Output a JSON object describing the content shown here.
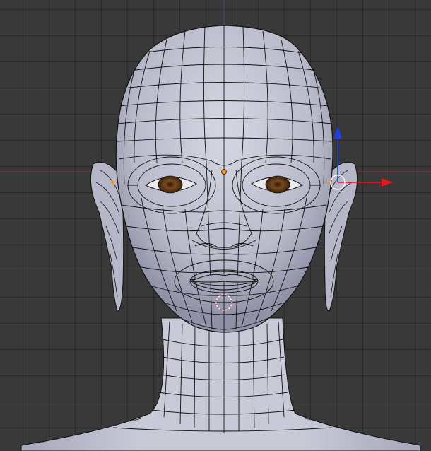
{
  "viewport": {
    "mode": "edit-mode",
    "view": "front-orthographic",
    "object": "head-mesh",
    "display": "wireframe-over-solid"
  },
  "colors": {
    "background": "#393939",
    "grid_line": "#2c2c2c",
    "x_axis": "#9b3a3a",
    "z_axis": "#3b4d8a",
    "mesh_surface": "#c4c6d6",
    "mesh_shadow": "#8c8ea3",
    "wire": "#101010",
    "selected_vertex": "#ff8c1a",
    "eye_iris": "#6b3c1a",
    "gizmo_x": "#e01b1b",
    "gizmo_z": "#1f3fe0",
    "cursor_3d": "#d84a4a"
  },
  "icons": {
    "transform_gizmo": "move-arrows-icon",
    "cursor": "3d-cursor-icon"
  }
}
